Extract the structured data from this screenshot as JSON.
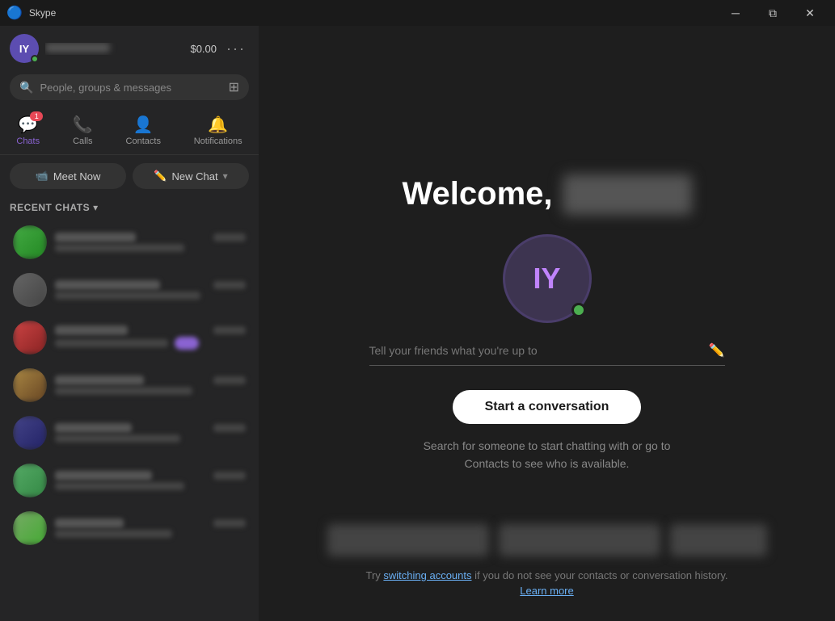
{
  "titlebar": {
    "title": "Skype",
    "minimize_label": "─",
    "restore_label": "⧉",
    "close_label": "✕"
  },
  "sidebar": {
    "profile": {
      "initials": "IY",
      "name_placeholder": "blur",
      "credit": "$0.00"
    },
    "search": {
      "placeholder": "People, groups & messages"
    },
    "nav_tabs": [
      {
        "id": "chats",
        "label": "Chats",
        "icon": "💬",
        "active": true,
        "badge": "1"
      },
      {
        "id": "calls",
        "label": "Calls",
        "icon": "📞",
        "active": false,
        "badge": null
      },
      {
        "id": "contacts",
        "label": "Contacts",
        "icon": "👤",
        "active": false,
        "badge": null
      },
      {
        "id": "notifications",
        "label": "Notifications",
        "icon": "🔔",
        "active": false,
        "badge": null
      }
    ],
    "buttons": {
      "meet_now": "Meet Now",
      "new_chat": "New Chat"
    },
    "recent_chats_label": "RECENT CHATS",
    "chat_items_count": 7
  },
  "main": {
    "welcome_prefix": "Welcome,",
    "avatar_initials": "IY",
    "status_placeholder": "Tell your friends what you're up to",
    "start_conversation_label": "Start a conversation",
    "help_text_line1": "Search for someone to start chatting with or go to",
    "help_text_line2": "Contacts to see who is available.",
    "footer_text_prefix": "Try ",
    "footer_link_text": "switching accounts",
    "footer_text_suffix": " if you do not see your contacts or conversation history.",
    "learn_more_label": "Learn more"
  }
}
